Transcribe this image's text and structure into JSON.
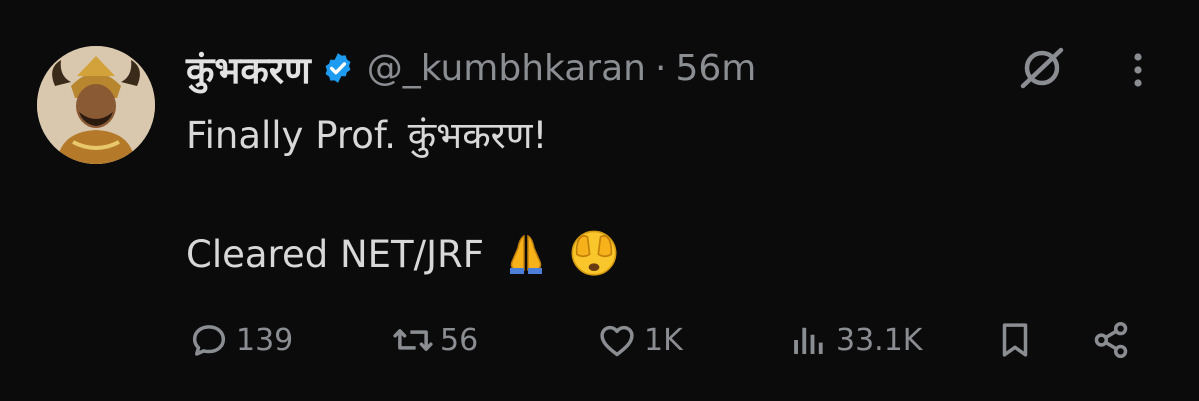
{
  "tweet": {
    "display_name": "कुंभकरण",
    "handle": "@_kumbhkaran",
    "separator": "·",
    "time": "56m",
    "text_line1": "Finally Prof. कुंभकरण!",
    "text_line2": "Cleared NET/JRF",
    "emojis": [
      "folded-hands-emoji",
      "face-covering-eyes-emoji"
    ]
  },
  "actions": {
    "replies": "139",
    "reposts": "56",
    "likes": "1K",
    "views": "33.1K"
  },
  "colors": {
    "background": "#0b0b0c",
    "text": "#d8d8d8",
    "muted": "#8a8d91",
    "verified": "#1d9bf0"
  }
}
